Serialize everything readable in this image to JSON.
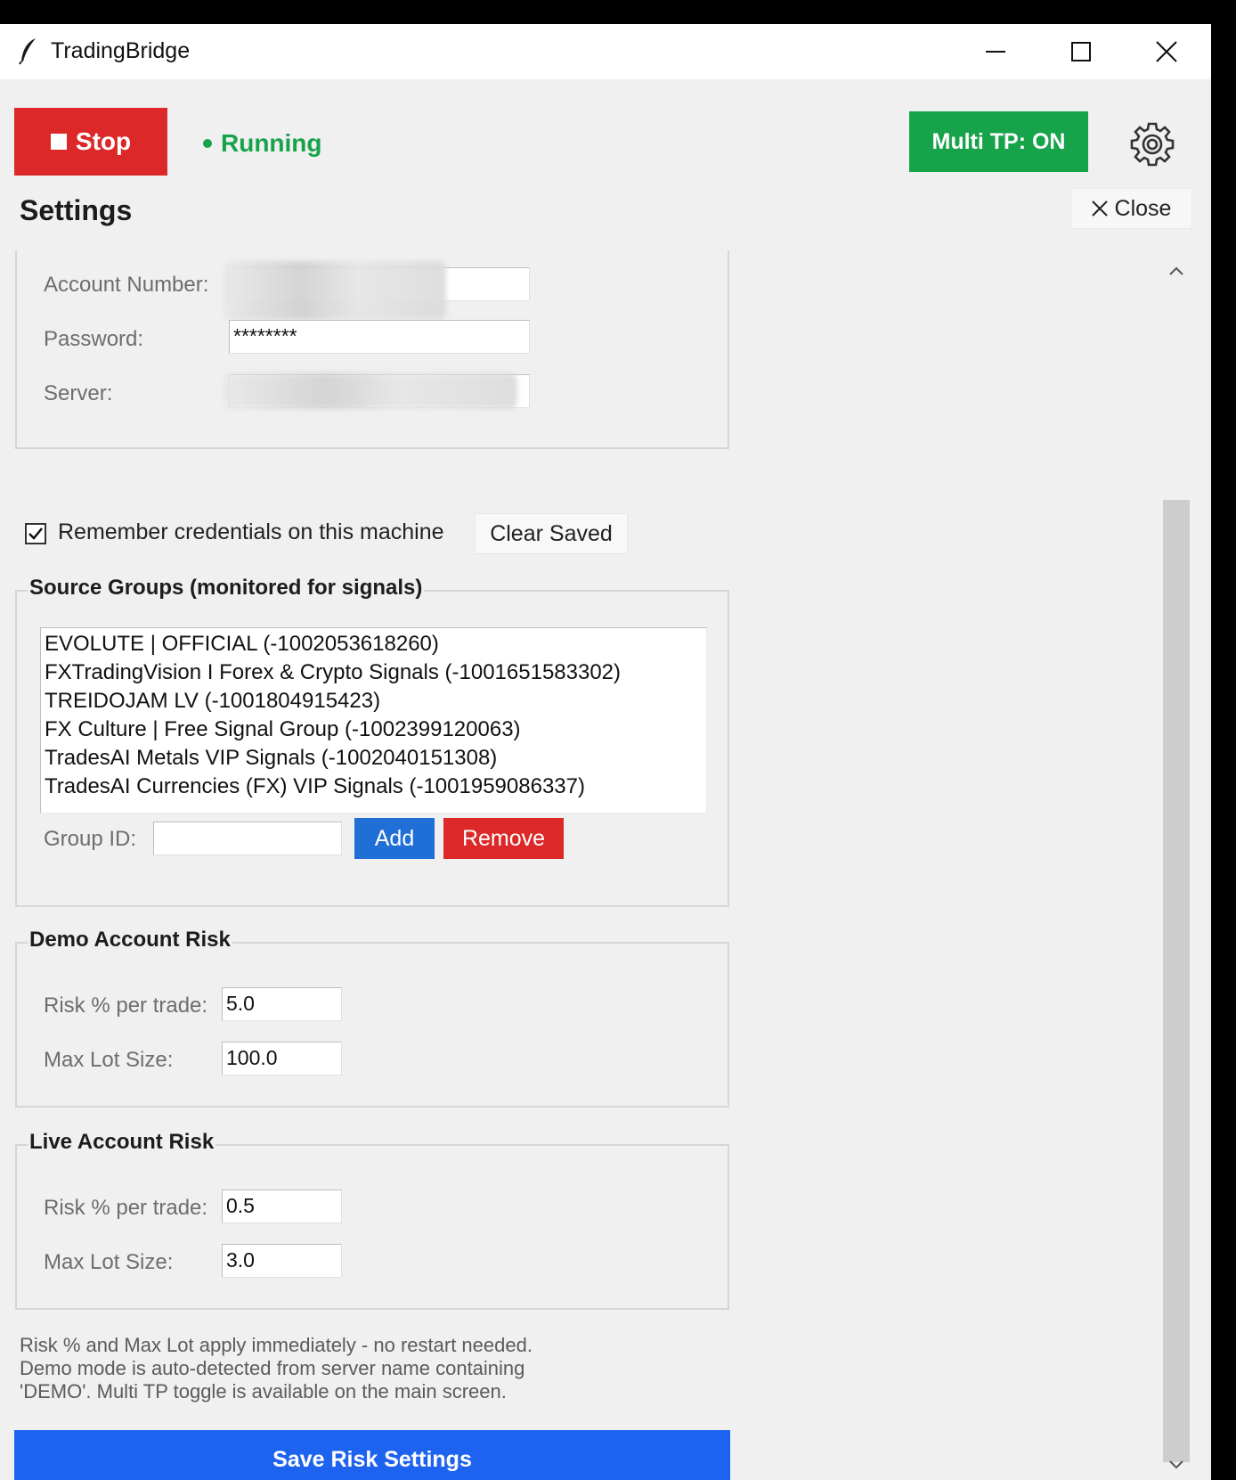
{
  "window": {
    "title": "TradingBridge",
    "icon": "feather-icon"
  },
  "header": {
    "stop_label": "Stop",
    "status_text": "Running",
    "multi_tp_label": "Multi TP: ON",
    "settings_icon": "gear-icon"
  },
  "settings": {
    "title": "Settings",
    "close_label": "Close"
  },
  "account": {
    "account_number_label": "Account Number:",
    "account_number_value": "",
    "password_label": "Password:",
    "password_value": "********",
    "server_label": "Server:",
    "server_value": ""
  },
  "credentials": {
    "remember_label": "Remember credentials on this machine",
    "remember_checked": true,
    "clear_saved_label": "Clear Saved"
  },
  "source_groups": {
    "legend": "Source Groups (monitored for signals)",
    "items": [
      "EVOLUTE | OFFICIAL  (-1002053618260)",
      "FXTradingVision I Forex & Crypto Signals  (-1001651583302)",
      "TREIDOJAM LV  (-1001804915423)",
      "FX Culture | Free Signal Group  (-1002399120063)",
      "TradesAI Metals VIP Signals  (-1002040151308)",
      "TradesAI Currencies (FX) VIP Signals  (-1001959086337)"
    ],
    "group_id_label": "Group ID:",
    "group_id_value": "",
    "add_label": "Add",
    "remove_label": "Remove"
  },
  "demo_risk": {
    "legend": "Demo Account Risk",
    "risk_label": "Risk % per trade:",
    "risk_value": "5.0",
    "max_lot_label": "Max Lot Size:",
    "max_lot_value": "100.0"
  },
  "live_risk": {
    "legend": "Live Account Risk",
    "risk_label": "Risk % per trade:",
    "risk_value": "0.5",
    "max_lot_label": "Max Lot Size:",
    "max_lot_value": "3.0"
  },
  "note": {
    "lines": [
      "Risk % and Max Lot apply immediately - no restart needed.",
      "Demo mode is auto-detected from server name containing",
      "'DEMO'. Multi TP toggle is available on the main screen."
    ]
  },
  "save_label": "Save Risk Settings",
  "colors": {
    "stop": "#dc2828",
    "running": "#17a34a",
    "multi_tp": "#16a34a",
    "add": "#1f6fd6",
    "remove": "#dc2828",
    "save": "#1e63f0"
  }
}
